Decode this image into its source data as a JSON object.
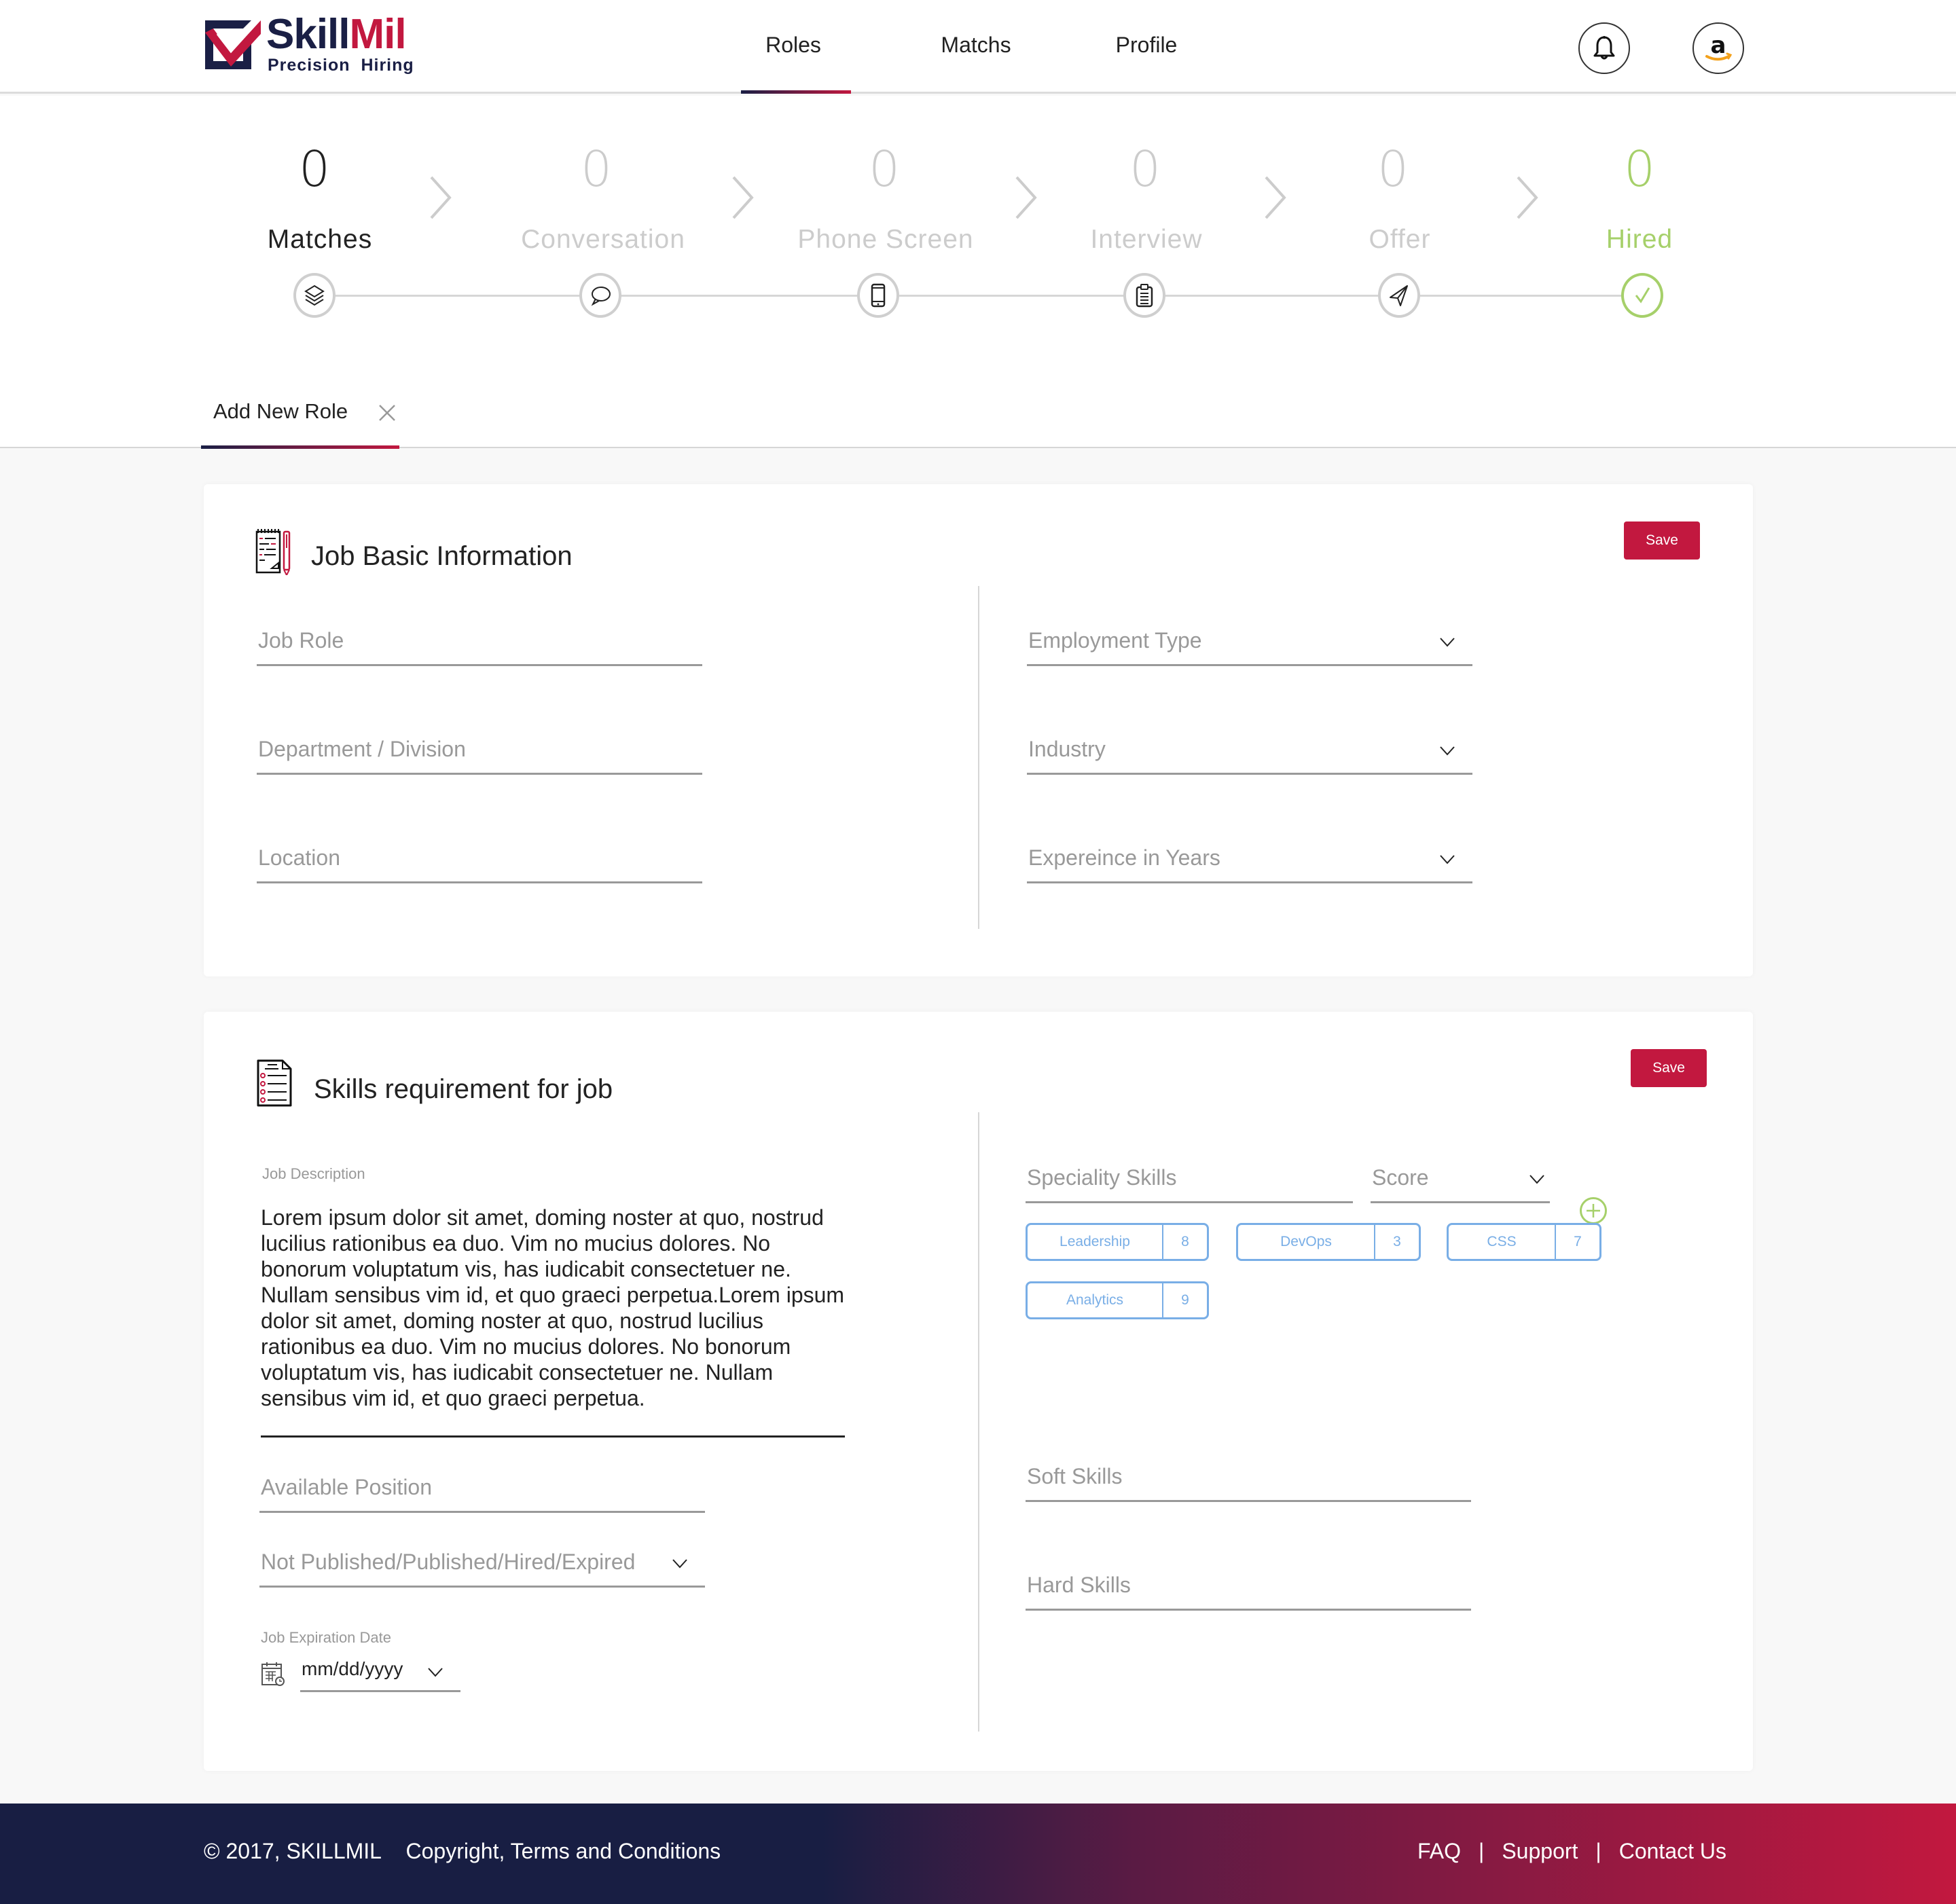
{
  "brand": {
    "name_part1": "Skill",
    "name_part2": "Mil",
    "tagline": "Precision  Hiring",
    "colors": {
      "navy": "#1a1f45",
      "crimson": "#c2183f",
      "green": "#a6d06a",
      "chip_blue": "#79aee6"
    }
  },
  "nav": {
    "items": [
      {
        "label": "Roles",
        "active": true
      },
      {
        "label": "Matchs",
        "active": false
      },
      {
        "label": "Profile",
        "active": false
      }
    ],
    "notification_icon": "bell-icon",
    "avatar_icon": "amazon-logo-icon"
  },
  "pipeline": {
    "stages": [
      {
        "label": "Matches",
        "count": "0",
        "icon": "layers-icon",
        "state": "active"
      },
      {
        "label": "Conversation",
        "count": "0",
        "icon": "chat-bubble-icon",
        "state": "inactive"
      },
      {
        "label": "Phone Screen",
        "count": "0",
        "icon": "phone-icon",
        "state": "inactive"
      },
      {
        "label": "Interview",
        "count": "0",
        "icon": "clipboard-icon",
        "state": "inactive"
      },
      {
        "label": "Offer",
        "count": "0",
        "icon": "paper-plane-icon",
        "state": "inactive"
      },
      {
        "label": "Hired",
        "count": "0",
        "icon": "check-icon",
        "state": "hired"
      }
    ]
  },
  "tab": {
    "label": "Add New Role",
    "close_icon": "close-icon"
  },
  "basic_info": {
    "title": "Job Basic Information",
    "save_label": "Save",
    "left_fields": [
      {
        "placeholder": "Job Role"
      },
      {
        "placeholder": "Department / Division"
      },
      {
        "placeholder": "Location"
      }
    ],
    "right_fields": [
      {
        "placeholder": "Employment Type",
        "type": "dropdown"
      },
      {
        "placeholder": "Industry",
        "type": "dropdown"
      },
      {
        "placeholder": "Expereince in Years",
        "type": "dropdown"
      }
    ]
  },
  "skills": {
    "title": "Skills requirement for job",
    "save_label": "Save",
    "job_description_label": "Job Description",
    "job_description": "Lorem ipsum dolor sit amet, doming noster at quo, nostrud lucilius rationibus ea duo. Vim no mucius dolores. No bonorum voluptatum vis, has iudicabit consectetuer ne. Nullam sensibus vim id, et quo graeci perpetua.Lorem ipsum dolor sit amet, doming noster at quo, nostrud lucilius rationibus ea duo. Vim no mucius dolores. No bonorum voluptatum vis, has iudicabit consectetuer ne. Nullam sensibus vim id, et quo graeci perpetua.",
    "available_position_placeholder": "Available Position",
    "status_placeholder": "Not Published/Published/Hired/Expired",
    "expiration_label": "Job Expiration Date",
    "expiration_placeholder": "mm/dd/yyyy",
    "speciality_placeholder": "Speciality Skills",
    "score_placeholder": "Score",
    "chips": [
      {
        "name": "Leadership",
        "score": "8"
      },
      {
        "name": "DevOps",
        "score": "3"
      },
      {
        "name": "CSS",
        "score": "7"
      },
      {
        "name": "Analytics",
        "score": "9"
      }
    ],
    "soft_skills_placeholder": "Soft Skills",
    "hard_skills_placeholder": "Hard Skills"
  },
  "footer": {
    "copyright": "© 2017, SKILLMIL",
    "terms": "Copyright, Terms and Conditions",
    "links": [
      "FAQ",
      "Support",
      "Contact Us"
    ],
    "separator": "|"
  }
}
